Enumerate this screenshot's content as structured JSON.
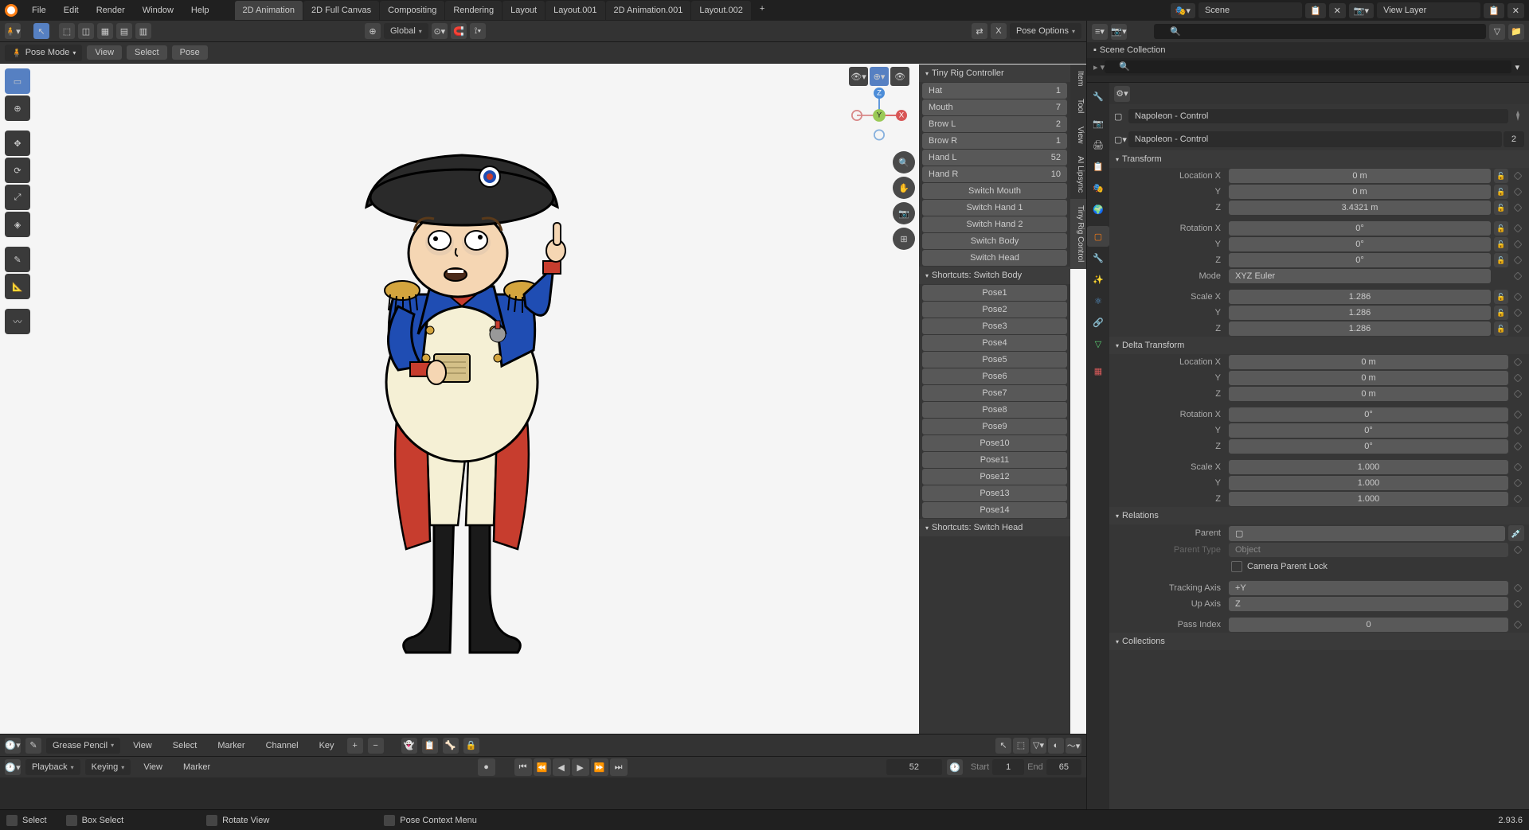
{
  "menus": [
    "File",
    "Edit",
    "Render",
    "Window",
    "Help"
  ],
  "workspaces": [
    "2D Animation",
    "2D Full Canvas",
    "Compositing",
    "Rendering",
    "Layout",
    "Layout.001",
    "2D Animation.001",
    "Layout.002"
  ],
  "active_workspace": 0,
  "scene_label": "Scene",
  "view_layer_label": "View Layer",
  "header": {
    "orientation": "Global",
    "pose_options": "Pose Options"
  },
  "mode": "Pose Mode",
  "sub_buttons": [
    "View",
    "Select",
    "Pose"
  ],
  "side_tabs": [
    "Item",
    "Tool",
    "View",
    "AI Lipsync",
    "Tiny Rig Control"
  ],
  "rig_panel": {
    "title": "Tiny Rig Controller",
    "rows": [
      {
        "label": "Hat",
        "val": "1"
      },
      {
        "label": "Mouth",
        "val": "7"
      },
      {
        "label": "Brow L",
        "val": "2"
      },
      {
        "label": "Brow R",
        "val": "1"
      },
      {
        "label": "Hand L",
        "val": "52"
      },
      {
        "label": "Hand R",
        "val": "10"
      }
    ],
    "switches": [
      "Switch Mouth",
      "Switch Hand 1",
      "Switch Hand 2",
      "Switch Body",
      "Switch Head"
    ],
    "shortcuts_body_title": "Shortcuts: Switch Body",
    "poses": [
      "Pose1",
      "Pose2",
      "Pose3",
      "Pose4",
      "Pose5",
      "Pose6",
      "Pose7",
      "Pose8",
      "Pose9",
      "Pose10",
      "Pose11",
      "Pose12",
      "Pose13",
      "Pose14"
    ],
    "shortcuts_head_title": "Shortcuts: Switch Head"
  },
  "outliner": {
    "collection": "Scene Collection"
  },
  "object": {
    "name": "Napoleon - Control",
    "users": "2"
  },
  "transform": {
    "title": "Transform",
    "location": {
      "x": "0 m",
      "y": "0 m",
      "z": "3.4321 m"
    },
    "rotation": {
      "x": "0°",
      "y": "0°",
      "z": "0°"
    },
    "mode": "XYZ Euler",
    "scale": {
      "x": "1.286",
      "y": "1.286",
      "z": "1.286"
    }
  },
  "delta": {
    "title": "Delta Transform",
    "location": {
      "x": "0 m",
      "y": "0 m",
      "z": "0 m"
    },
    "rotation": {
      "x": "0°",
      "y": "0°",
      "z": "0°"
    },
    "scale": {
      "x": "1.000",
      "y": "1.000",
      "z": "1.000"
    }
  },
  "relations": {
    "title": "Relations",
    "parent": "Parent",
    "parent_type_label": "Parent Type",
    "parent_type": "Object",
    "camera_lock": "Camera Parent Lock",
    "tracking_axis_label": "Tracking Axis",
    "tracking_axis": "+Y",
    "up_axis_label": "Up Axis",
    "up_axis": "Z",
    "pass_index_label": "Pass Index",
    "pass_index": "0"
  },
  "collections_title": "Collections",
  "dopesheet": {
    "mode": "Grease Pencil",
    "menus": [
      "View",
      "Select",
      "Marker",
      "Channel",
      "Key"
    ]
  },
  "timeline": {
    "playback": "Playback",
    "keying": "Keying",
    "view": "View",
    "marker": "Marker",
    "current": "52",
    "start_label": "Start",
    "start": "1",
    "end_label": "End",
    "end": "65"
  },
  "status": {
    "select": "Select",
    "box": "Box Select",
    "rotate": "Rotate View",
    "context": "Pose Context Menu",
    "version": "2.93.6"
  }
}
